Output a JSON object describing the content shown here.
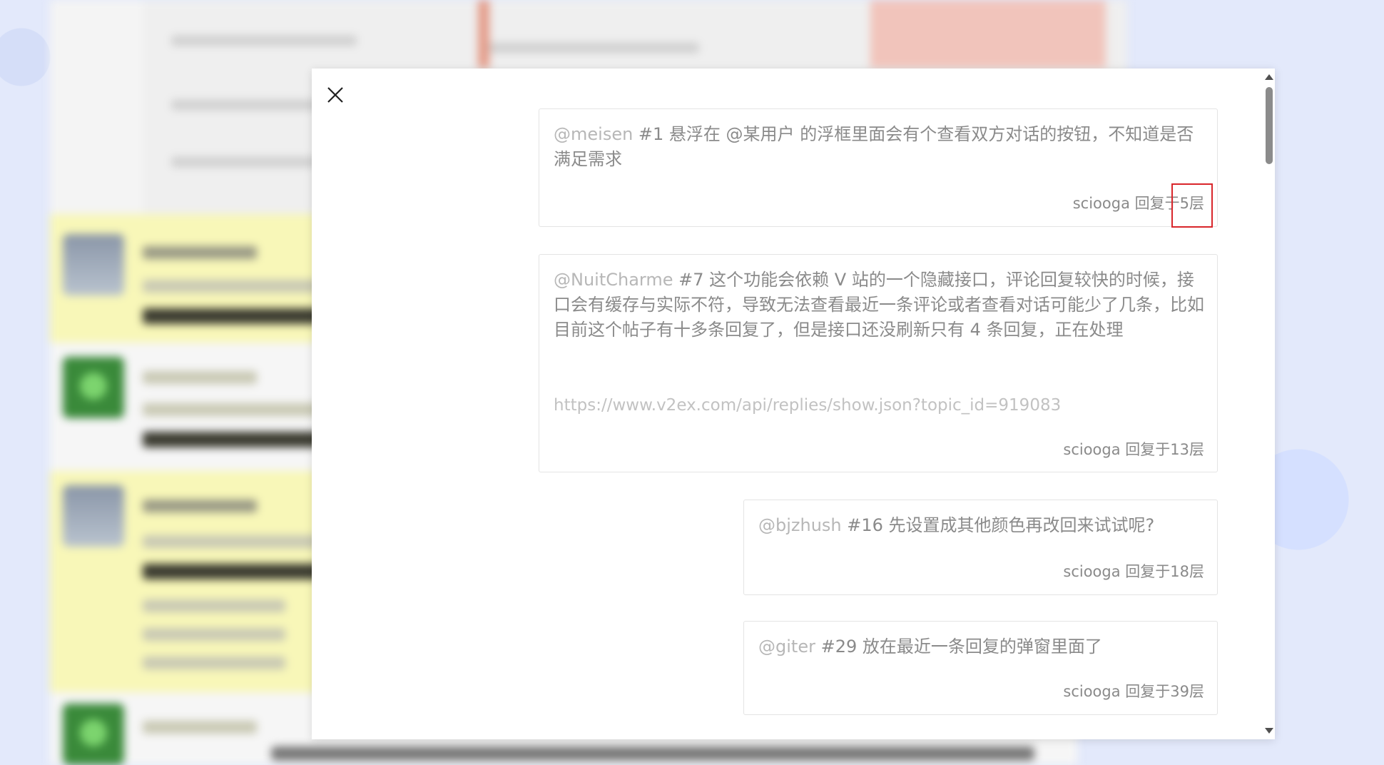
{
  "modal": {
    "close_icon": "close-icon",
    "replies": [
      {
        "mention": "@meisen",
        "text": " #1 悬浮在 @某用户 的浮框里面会有个查看双方对话的按钮，不知道是否满足需求",
        "link": "",
        "meta": "sciooga 回复于5层"
      },
      {
        "mention": "@NuitCharme",
        "text": " #7 这个功能会依赖 V 站的一个隐藏接口，评论回复较快的时候，接口会有缓存与实际不符，导致无法查看最近一条评论或者查看对话可能少了几条，比如目前这个帖子有十多条回复了，但是接口还没刷新只有 4 条回复，正在处理",
        "link": "https://www.v2ex.com/api/replies/show.json?topic_id=919083",
        "meta": "sciooga 回复于13层"
      },
      {
        "mention": "@bjzhush",
        "text": " #16 先设置成其他颜色再改回来试试呢?",
        "link": "",
        "meta": "sciooga 回复于18层"
      },
      {
        "mention": "@giter",
        "text": " #29 放在最近一条回复的弹窗里面了",
        "link": "",
        "meta": "sciooga 回复于39层"
      }
    ]
  },
  "colors": {
    "highlight": "#d9262b",
    "text": "#8a8a8a",
    "mention": "#b7b7b7"
  }
}
